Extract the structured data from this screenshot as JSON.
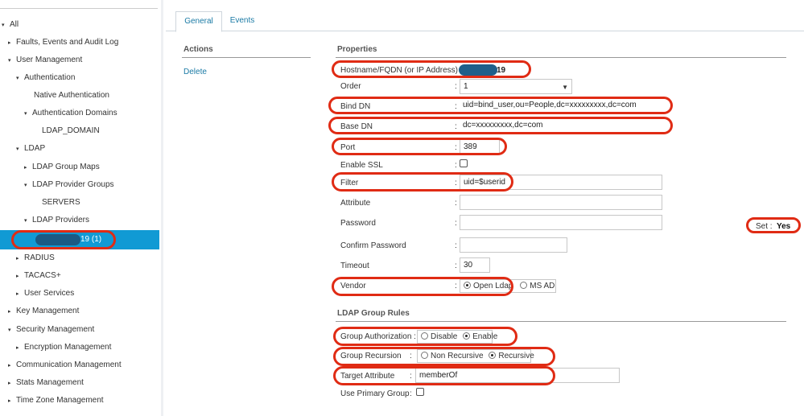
{
  "sidebar": {
    "items": [
      {
        "label": "All",
        "tri": "▾"
      },
      {
        "label": "Faults, Events and Audit Log",
        "tri": "▸"
      },
      {
        "label": "User Management",
        "tri": "▾"
      },
      {
        "label": "Authentication",
        "tri": "▾"
      },
      {
        "label": "Native Authentication",
        "tri": ""
      },
      {
        "label": "Authentication Domains",
        "tri": "▾"
      },
      {
        "label": "LDAP_DOMAIN",
        "tri": ""
      },
      {
        "label": "LDAP",
        "tri": "▾"
      },
      {
        "label": "LDAP Group Maps",
        "tri": "▸"
      },
      {
        "label": "LDAP Provider Groups",
        "tri": "▾"
      },
      {
        "label": "SERVERS",
        "tri": ""
      },
      {
        "label": "LDAP Providers",
        "tri": "▾"
      },
      {
        "label": "19 (1)",
        "tri": ""
      },
      {
        "label": "RADIUS",
        "tri": "▸"
      },
      {
        "label": "TACACS+",
        "tri": "▸"
      },
      {
        "label": "User Services",
        "tri": "▸"
      },
      {
        "label": "Key Management",
        "tri": "▸"
      },
      {
        "label": "Security Management",
        "tri": "▾"
      },
      {
        "label": "Encryption Management",
        "tri": "▸"
      },
      {
        "label": "Communication Management",
        "tri": "▸"
      },
      {
        "label": "Stats Management",
        "tri": "▸"
      },
      {
        "label": "Time Zone Management",
        "tri": "▸"
      }
    ]
  },
  "tabs": {
    "general": "General",
    "events": "Events"
  },
  "actions": {
    "heading": "Actions",
    "delete": "Delete"
  },
  "properties": {
    "heading": "Properties",
    "hostname_label": "Hostname/FQDN (or IP Address) :",
    "hostname_value": "19",
    "order_label": "Order",
    "order_value": "1",
    "bind_dn_label": "Bind DN",
    "bind_dn_value": "uid=bind_user,ou=People,dc=xxxxxxxxx,dc=com",
    "base_dn_label": "Base DN",
    "base_dn_value": "dc=xxxxxxxxx,dc=com",
    "port_label": "Port",
    "port_value": "389",
    "ssl_label": "Enable SSL",
    "filter_label": "Filter",
    "filter_value": "uid=$userid",
    "attribute_label": "Attribute",
    "attribute_value": "",
    "password_label": "Password",
    "set_label": "Set :",
    "set_value": "Yes",
    "confirm_label": "Confirm Password",
    "timeout_label": "Timeout",
    "timeout_value": "30",
    "vendor_label": "Vendor",
    "vendor_open": "Open Ldap",
    "vendor_ms": "MS AD",
    "colon": ":"
  },
  "group_rules": {
    "heading": "LDAP Group Rules",
    "auth_label": "Group Authorization :",
    "auth_disable": "Disable",
    "auth_enable": "Enable",
    "recursion_label": "Group Recursion",
    "recursion_non": "Non Recursive",
    "recursion_rec": "Recursive",
    "target_label": "Target Attribute",
    "target_value": "memberOf",
    "primary_label": "Use Primary Group",
    "colon": ":"
  },
  "colors": {
    "accent": "#119ad4",
    "highlight": "#e02b14",
    "link": "#1a7aa5"
  }
}
